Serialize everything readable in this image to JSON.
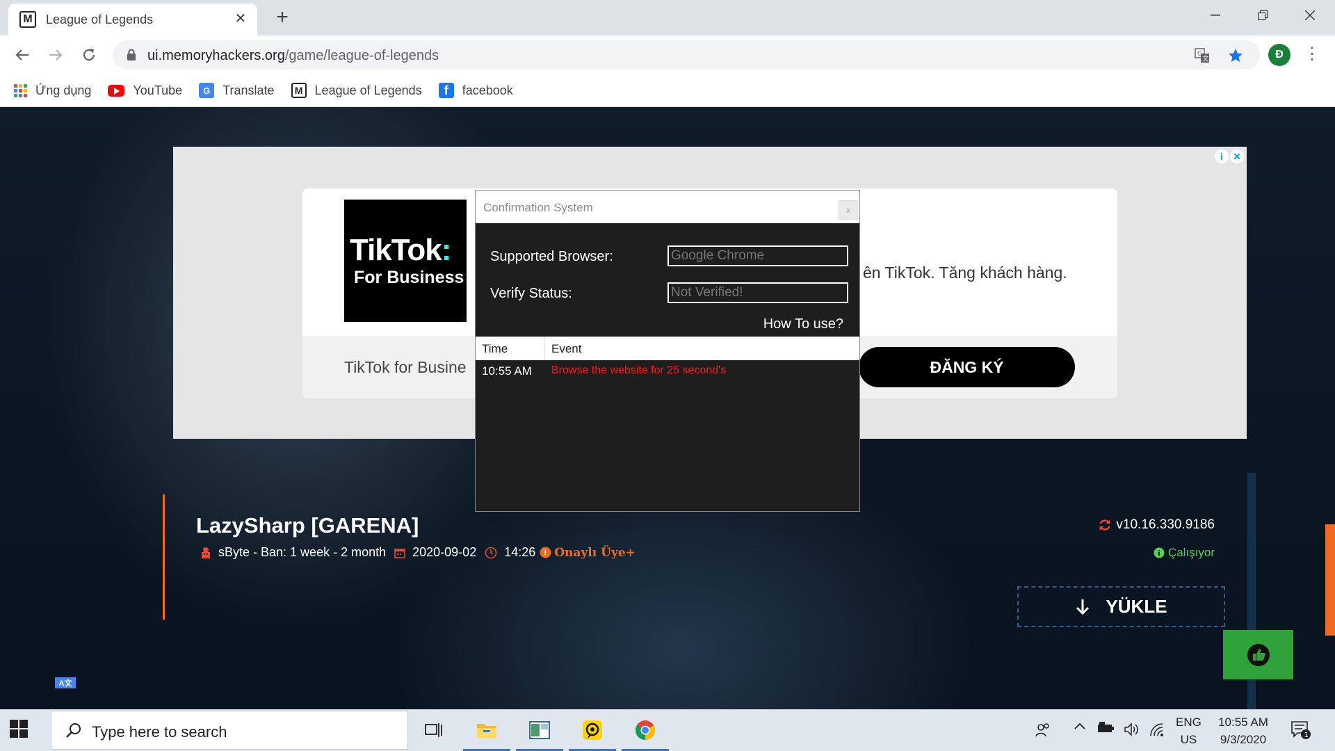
{
  "browser": {
    "tab_title": "League of Legends",
    "favicon_letter": "M",
    "url_host": "ui.memoryhackers.org",
    "url_path": "/game/league-of-legends",
    "profile_initial": "Đ"
  },
  "bookmarks": [
    {
      "label": "Ứng dụng",
      "icon": "apps-grid-icon"
    },
    {
      "label": "YouTube",
      "icon": "youtube-icon"
    },
    {
      "label": "Translate",
      "icon": "google-translate-icon"
    },
    {
      "label": "League of Legends",
      "icon": "memoryhackers-icon"
    },
    {
      "label": "facebook",
      "icon": "facebook-icon"
    }
  ],
  "ad": {
    "logo_line1": "TikTok",
    "logo_line2": "For Business",
    "body": "ên TikTok. Tăng khách hàng.",
    "brand": "TikTok for Busine",
    "cta": "ĐĂNG KÝ"
  },
  "dialog": {
    "title": "Confirmation System",
    "close": "x",
    "browser_label": "Supported Browser:",
    "browser_value": "Google Chrome",
    "verify_label": "Verify Status:",
    "verify_value": "Not Verified!",
    "how_to": "How To use?",
    "col_time": "Time",
    "col_event": "Event",
    "log": [
      {
        "time": "10:55 AM",
        "event": "Browse the website for 25 second's"
      }
    ]
  },
  "product": {
    "title": "LazySharp [GARENA]",
    "author": "sByte - Ban: 1 week - 2 month",
    "date": "2020-09-02",
    "time": "14:26",
    "badge": "Onaylı Üye+",
    "version": "v10.16.330.9186",
    "status": "Çalışıyor",
    "download_label": "YÜKLE"
  },
  "taskbar": {
    "search_placeholder": "Type here to search",
    "lang_top": "ENG",
    "lang_bottom": "US",
    "clock_time": "10:55 AM",
    "clock_date": "9/3/2020",
    "notification_count": "1"
  },
  "colors": {
    "accent_orange": "#f26b1d",
    "status_green": "#52d34a",
    "like_green": "#2fa23a",
    "error_red": "#ff1a1a"
  }
}
